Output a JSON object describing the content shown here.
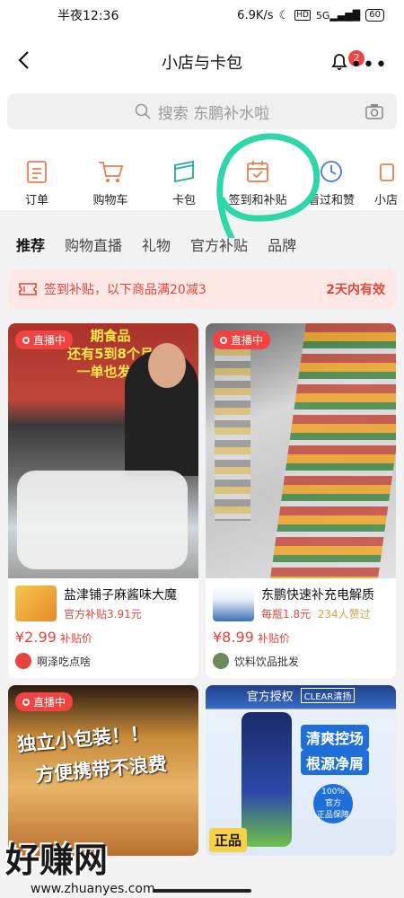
{
  "status": {
    "time": "半夜12:36",
    "speed": "6.9K/s",
    "battery": "60"
  },
  "header": {
    "title": "小店与卡包",
    "badge": "2"
  },
  "search": {
    "placeholder": "搜索 东鹏补水啦"
  },
  "quick": [
    {
      "label": "订单",
      "icon": "order-icon"
    },
    {
      "label": "购物车",
      "icon": "cart-icon"
    },
    {
      "label": "卡包",
      "icon": "card-wallet-icon"
    },
    {
      "label": "签到和补贴",
      "icon": "calendar-check-icon"
    },
    {
      "label": "看过和赞",
      "icon": "clock-icon"
    },
    {
      "label": "小店",
      "icon": "shop-icon"
    }
  ],
  "tabs": [
    "推荐",
    "购物直播",
    "礼物",
    "官方补贴",
    "品牌"
  ],
  "banner": {
    "text": "签到补贴，以下商品满20减3",
    "right": "2天内有效"
  },
  "products": [
    {
      "live": "直播中",
      "name": "盐津铺子麻酱味大魔",
      "sub": "官方补贴3.91元",
      "sub2": "",
      "price": "¥2.99",
      "price_tag": "补贴价",
      "shop": "啊泽吃点啥",
      "img_text": [
        "期食品",
        "还有5到8个月",
        "一单也发货"
      ]
    },
    {
      "live": "直播中",
      "name": "东鹏快速补充电解质",
      "sub": "每瓶1.8元",
      "sub2": "234人赞过",
      "price": "¥8.99",
      "price_tag": "补贴价",
      "shop": "饮料饮品批发"
    },
    {
      "live": "直播中",
      "img_text": [
        "独立小包装！！",
        "方便携带不浪费"
      ]
    },
    {
      "img_text": [
        "官方授权",
        "CLEAR清扬",
        "清爽控场",
        "根源净屑",
        "100%",
        "官方",
        "正品保障",
        "正品"
      ]
    }
  ],
  "watermark": {
    "big": "好赚网",
    "small": "www.zhuanyes.com"
  }
}
